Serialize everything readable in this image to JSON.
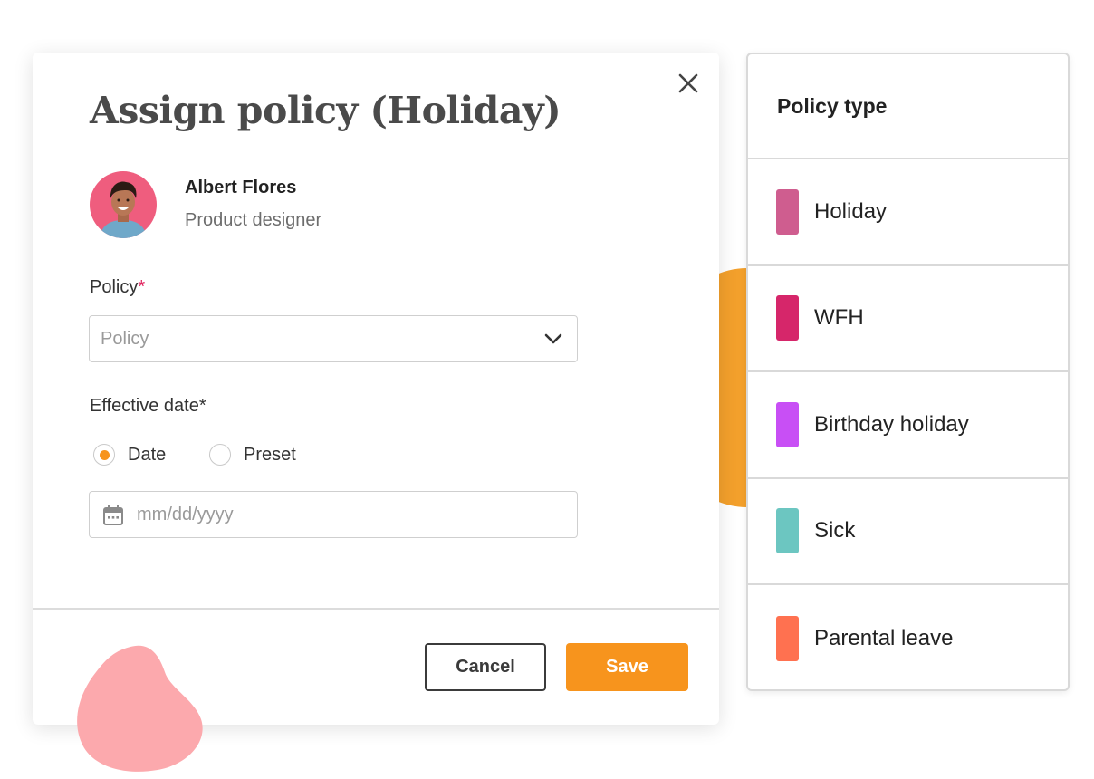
{
  "modal": {
    "title": "Assign policy (Holiday)",
    "close_icon": "close-icon",
    "user": {
      "name": "Albert Flores",
      "role": "Product designer"
    },
    "policy_field": {
      "label": "Policy",
      "required_mark": "*",
      "placeholder": "Policy",
      "value": ""
    },
    "effective_date": {
      "label": "Effective date*",
      "options": [
        {
          "label": "Date",
          "selected": true
        },
        {
          "label": "Preset",
          "selected": false
        }
      ],
      "placeholder": "mm/dd/yyyy",
      "value": ""
    },
    "buttons": {
      "cancel": "Cancel",
      "save": "Save"
    }
  },
  "policy_panel": {
    "title": "Policy type",
    "items": [
      {
        "label": "Holiday",
        "color": "#cf5d8f"
      },
      {
        "label": "WFH",
        "color": "#d6266a"
      },
      {
        "label": "Birthday holiday",
        "color": "#c84ff5"
      },
      {
        "label": "Sick",
        "color": "#6cc6c1"
      },
      {
        "label": "Parental leave",
        "color": "#ff7150"
      }
    ]
  },
  "colors": {
    "accent": "#f7941d",
    "decor_orange": "#f3a02c",
    "decor_pink": "#fca9ad",
    "avatar_bg": "#ef5d7e"
  }
}
